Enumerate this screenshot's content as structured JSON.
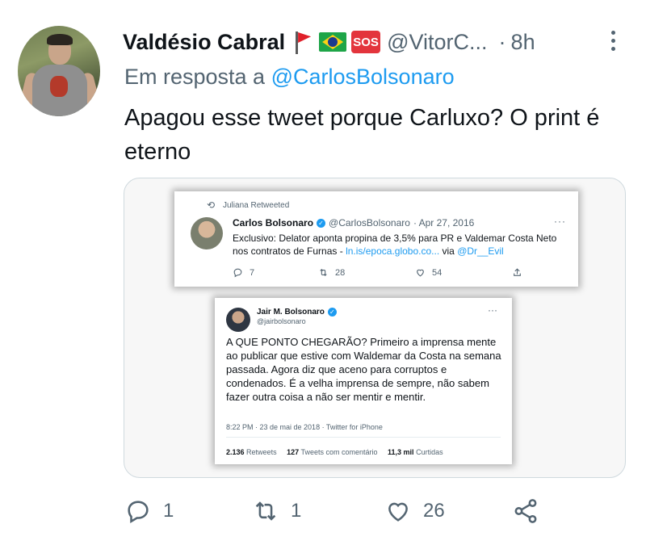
{
  "author": {
    "name": "Valdésio Cabral",
    "sos_label": "SOS",
    "handle": "@VitorC...",
    "dot": "·",
    "time": "8h"
  },
  "reply": {
    "prefix": "Em resposta a",
    "mention": "@CarlosBolsonaro"
  },
  "tweet_text": "Apagou esse tweet porque Carluxo? O print é eterno",
  "embedded": {
    "shot1": {
      "retweet_by": "Juliana Retweeted",
      "name": "Carlos Bolsonaro",
      "handle": "@CarlosBolsonaro",
      "date": "· Apr 27, 2016",
      "dots": "···",
      "text": "Exclusivo: Delator aponta propina de 3,5% para PR e Valdemar Costa Neto nos contratos de Furnas -",
      "link": "ln.is/epoca.globo.co...",
      "via": "via",
      "via_user": "@Dr__Evil",
      "replies": "7",
      "retweets": "28",
      "likes": "54"
    },
    "shot2": {
      "name": "Jair M. Bolsonaro",
      "handle": "@jairbolsonaro",
      "dots": "···",
      "text": "A QUE PONTO CHEGARÃO? Primeiro a imprensa mente ao publicar que estive com Waldemar da Costa na semana passada. Agora diz que aceno para corruptos e condenados. É a velha imprensa de sempre, não sabem fazer outra coisa a não ser mentir e mentir.",
      "meta": "8:22 PM · 23 de mai de 2018 · Twitter for iPhone",
      "retweets_count": "2.136",
      "retweets_label": "Retweets",
      "comments_count": "127",
      "comments_label": "Tweets com comentário",
      "likes_count": "11,3 mil",
      "likes_label": "Curtidas"
    }
  },
  "actions": {
    "replies": "1",
    "retweets": "1",
    "likes": "26"
  },
  "icons": [
    "red-flag-icon",
    "brazil-flag-icon",
    "sos-icon",
    "more-icon",
    "reply-icon",
    "retweet-icon",
    "like-icon",
    "share-icon",
    "verified-icon"
  ],
  "colors": {
    "link": "#1d9bf0",
    "secondary": "#536471",
    "text": "#0f1419"
  }
}
